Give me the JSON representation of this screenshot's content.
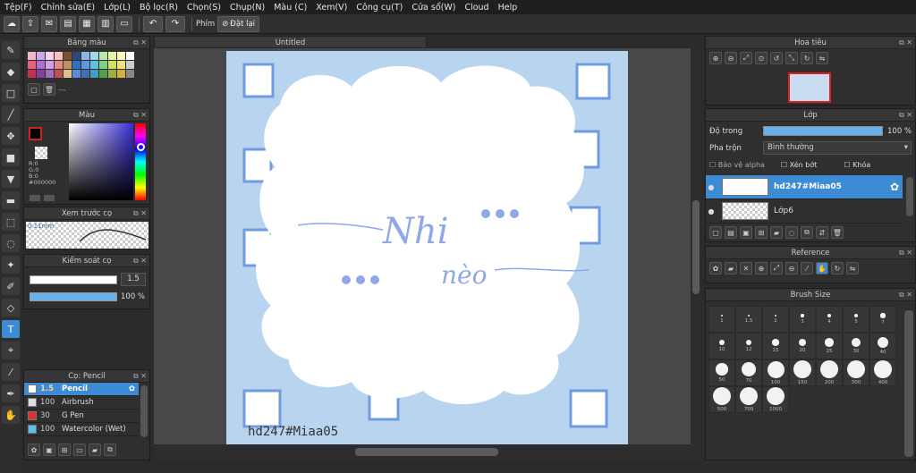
{
  "menu": [
    "Tệp(F)",
    "Chỉnh sửa(E)",
    "Lớp(L)",
    "Bộ lọc(R)",
    "Chọn(S)",
    "Chụp(N)",
    "Màu (C)",
    "Xem(V)",
    "Công cụ(T)",
    "Cửa sổ(W)",
    "Cloud",
    "Help"
  ],
  "toolbar": {
    "shortcut_label": "Phím",
    "reset_label": "Đặt lại"
  },
  "panels": {
    "swatches_title": "Bảng màu",
    "swatch_name": "---",
    "color_title": "Màu",
    "color_r": "R:0",
    "color_g": "G:0",
    "color_b": "B:0",
    "color_hex": "#000000",
    "preview_title": "Xem trước cọ",
    "preview_size": "0.11mm",
    "brush_control_title": "Kiểm soát cọ",
    "brush_size_value": "1.5",
    "brush_opacity_value": "100 %",
    "brush_list_title": "Cọ: Pencil",
    "navigator_title": "Hoa tiêu",
    "layer_title": "Lớp",
    "opacity_label": "Độ trong",
    "opacity_value": "100 %",
    "blend_label": "Pha trộn",
    "blend_value": "Bình thường",
    "protect_alpha": "Bảo vệ alpha",
    "clipping": "Xén bớt",
    "lock": "Khóa",
    "reference_title": "Reference",
    "brush_size_title": "Brush Size"
  },
  "document": {
    "tab": "Untitled",
    "sign": "hd247#Miaa05",
    "lettering_1": "Nhi",
    "lettering_2": "nèo"
  },
  "brushes": [
    {
      "size": "1.5",
      "name": "Pencil",
      "color": "#ffffff",
      "selected": true
    },
    {
      "size": "100",
      "name": "Airbrush",
      "color": "#dddddd",
      "selected": false
    },
    {
      "size": "30",
      "name": "G Pen",
      "color": "#e03030",
      "selected": false
    },
    {
      "size": "100",
      "name": "Watercolor (Wet)",
      "color": "#5fc0f0",
      "selected": false
    }
  ],
  "layers": [
    {
      "name": "hd247#Miaa05",
      "selected": true
    },
    {
      "name": "Lớp6",
      "selected": false
    }
  ],
  "brush_sizes": [
    "1",
    "1.5",
    "2",
    "3",
    "4",
    "5",
    "7",
    "10",
    "12",
    "15",
    "20",
    "25",
    "30",
    "40",
    "50",
    "70",
    "100",
    "150",
    "200",
    "300",
    "400",
    "500",
    "700",
    "1000"
  ],
  "colors": {
    "accent": "#3d8bd4",
    "canvas_blue": "#b8d4ef",
    "lettering": "#8fa8e6"
  }
}
